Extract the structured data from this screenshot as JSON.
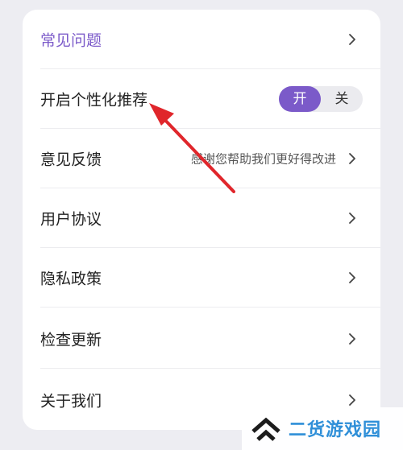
{
  "settings": {
    "items": [
      {
        "label": "常见问题"
      },
      {
        "label": "开启个性化推荐",
        "toggle": {
          "on_label": "开",
          "off_label": "关",
          "state": "on"
        }
      },
      {
        "label": "意见反馈",
        "subtitle": "感谢您帮助我们更好得改进"
      },
      {
        "label": "用户协议"
      },
      {
        "label": "隐私政策"
      },
      {
        "label": "检查更新"
      },
      {
        "label": "关于我们"
      }
    ]
  },
  "colors": {
    "accent": "#7b5ac9",
    "annotation_arrow": "#e0262b",
    "watermark_text": "#2f8fd8",
    "background": "#ededf2"
  },
  "watermark": {
    "text": "二货游戏园"
  },
  "icons": {
    "chevron": "chevron-right-icon",
    "watermark_logo": "double-chevron-up-icon"
  }
}
